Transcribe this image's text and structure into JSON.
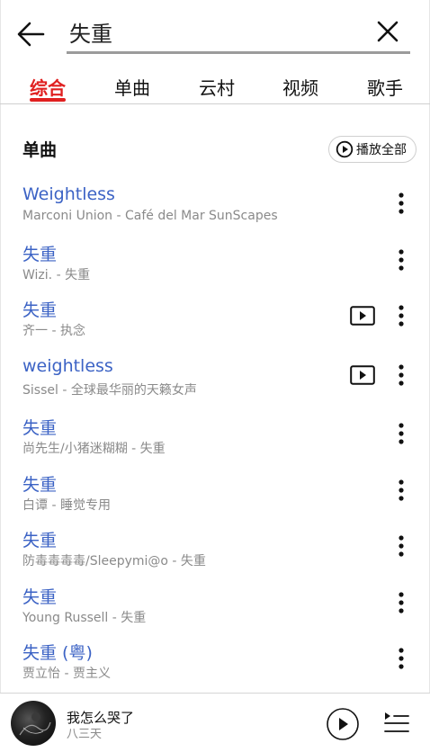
{
  "search": {
    "query": "失重"
  },
  "tabs": [
    {
      "label": "综合",
      "active": true
    },
    {
      "label": "单曲",
      "active": false
    },
    {
      "label": "云村",
      "active": false
    },
    {
      "label": "视频",
      "active": false
    },
    {
      "label": "歌手",
      "active": false
    }
  ],
  "section": {
    "title": "单曲",
    "play_all_label": "播放全部"
  },
  "songs": [
    {
      "title": "Weightless",
      "subtitle": "Marconi Union - Café del Mar SunScapes",
      "has_mv": false
    },
    {
      "title": "失重",
      "subtitle": "Wizi. - 失重",
      "has_mv": false
    },
    {
      "title": "失重",
      "subtitle": "齐一 - 执念",
      "has_mv": true
    },
    {
      "title": "weightless",
      "subtitle": "Sissel - 全球最华丽的天籁女声",
      "has_mv": true
    },
    {
      "title": "失重",
      "subtitle": "尚先生/小猪迷糊糊 - 失重",
      "has_mv": false
    },
    {
      "title": "失重",
      "subtitle": "白谭 - 睡觉专用",
      "has_mv": false
    },
    {
      "title": "失重",
      "subtitle": "防毒毒毒毒/Sleepymi@o - 失重",
      "has_mv": false
    },
    {
      "title": "失重",
      "subtitle": "Young Russell - 失重",
      "has_mv": false
    },
    {
      "title": "失重 (粤)",
      "subtitle": "贾立怡 - 贾主义",
      "has_mv": false
    }
  ],
  "player": {
    "title": "我怎么哭了",
    "artist": "八三天"
  },
  "colors": {
    "accent": "#e02020",
    "link": "#3c63c5",
    "muted": "#8a8a8a"
  },
  "icons": [
    "back-arrow-icon",
    "close-icon",
    "play-circle-icon",
    "mv-icon",
    "more-vertical-icon",
    "play-icon",
    "playlist-icon"
  ]
}
